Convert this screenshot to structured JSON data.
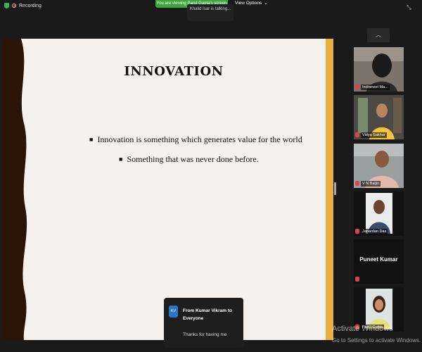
{
  "top_bar": {
    "recording_label": "Recording",
    "viewing_banner": "You are viewing Parul Gupta's screen",
    "view_options_label": "View Options",
    "talking_label": "Khalid Isar is talking..."
  },
  "slide": {
    "title": "INNOVATION",
    "bullets": [
      "Innovation is something which generates value for the world",
      "Something that was never done before."
    ],
    "colors": {
      "background": "#f5f1ef",
      "left_wave": "#2a1407",
      "right_bar": "#e7b141"
    }
  },
  "participants": [
    {
      "name": "Indraneel Ma...",
      "video": true
    },
    {
      "name": "Vidya Sakhar",
      "video": true
    },
    {
      "name": "V N Baljiri",
      "video": true
    },
    {
      "name": "Janardan Das",
      "video": true
    },
    {
      "name": "Puneet Kumar",
      "video": false
    },
    {
      "name": "Parul Gupta",
      "video": true
    }
  ],
  "chat_popup": {
    "avatar_initials": "KV",
    "from": "From Kumar Vikram to Everyone",
    "message": "Thanks for having me"
  },
  "watermark": {
    "line1": "Activate Windows",
    "line2": "Go to Settings to activate Windows."
  }
}
